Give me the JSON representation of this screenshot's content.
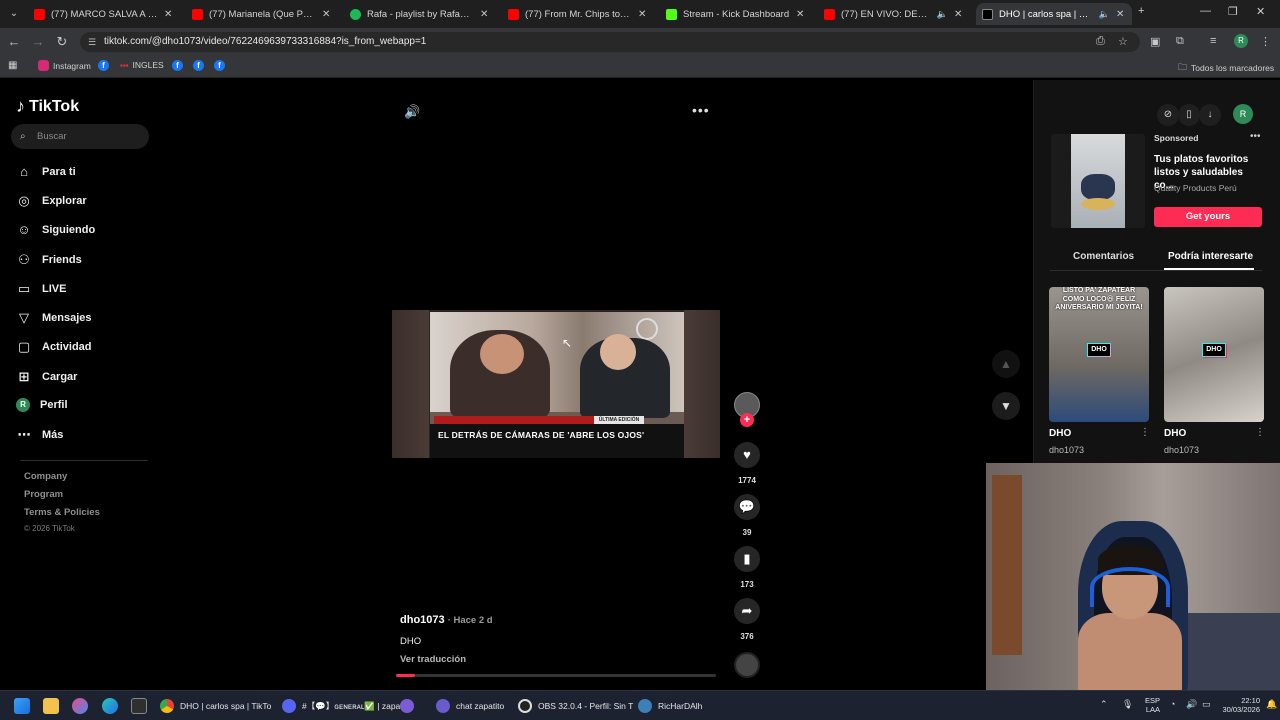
{
  "browser": {
    "tabs": [
      {
        "title": "(77) MARCO SALVA A GRACE D",
        "color": "#ff0000"
      },
      {
        "title": "(77) Marianela (Que Pasa) (Exte",
        "color": "#ff0000"
      },
      {
        "title": "Rafa - playlist by RafaelLxared |",
        "color": "#1db954"
      },
      {
        "title": "(77) From Mr. Chips to Scarface",
        "color": "#ff0000"
      },
      {
        "title": "Stream - Kick Dashboard",
        "color": "#53fc18"
      },
      {
        "title": "(77) EN VIVO: DEBATE PRES",
        "color": "#ff0000"
      },
      {
        "title": "DHO | carlos spa | TikTok",
        "color": "#ffffff"
      }
    ],
    "url": "tiktok.com/@dho1073/video/7622469639733316884?is_from_webapp=1",
    "profile_initial": "R",
    "bookmarks": {
      "instagram": "Instagram",
      "ingles": "INGLES",
      "all_bookmarks": "Todos los marcadores"
    }
  },
  "tiktok": {
    "logo": "TikTok",
    "search_placeholder": "Buscar",
    "nav": {
      "for_you": "Para ti",
      "explore": "Explorar",
      "following": "Siguiendo",
      "friends": "Friends",
      "live": "LIVE",
      "messages": "Mensajes",
      "activity": "Actividad",
      "upload": "Cargar",
      "profile": "Perfil",
      "profile_initial": "R",
      "more": "Más"
    },
    "footer": {
      "company": "Company",
      "program": "Program",
      "terms": "Terms & Policies",
      "copyright": "© 2026 TikTok"
    },
    "video": {
      "caption": "EL DETRÁS DE CÁMARAS DE 'ABRE LOS OJOS'",
      "badge": "ÚLTIMA EDICIÓN",
      "author": "dho1073",
      "time": "· Hace 2 d",
      "description": "DHO",
      "translate": "Ver traducción",
      "progress": 0.06,
      "likes": "1774",
      "comments": "39",
      "saves": "173",
      "shares": "376"
    },
    "panel": {
      "sponsored": "Sponsored",
      "ad_title": "Tus platos favoritos listos y saludables co...",
      "ad_brand": "Quality Products Perú",
      "ad_button": "Get yours",
      "tab_comments": "Comentarios",
      "tab_interest": "Podría interesarte",
      "profile_initial": "R",
      "items": [
        {
          "caption": "LISTO PA' ZAPATEAR COMO LOCO😆 FELIZ ANIVERSARIO MI JOYITA!",
          "tag": "DHO",
          "name": "DHO",
          "user": "dho1073"
        },
        {
          "caption": "",
          "tag": "DHO",
          "name": "DHO",
          "user": "dho1073"
        }
      ]
    }
  },
  "taskbar": {
    "items": {
      "chrome": "DHO | carlos spa | TikTo",
      "discord": "#【💬】ɢᴇɴᴇʀᴀʟ✅ | zapa",
      "chat": "chat zapatito",
      "obs": "OBS 32.0.4 - Perfil: Sin T",
      "rich": "RicHarDAlh"
    },
    "lang": "ESP",
    "lang2": "LAA",
    "time": "22:10",
    "date": "30/03/2026"
  },
  "colors": {
    "tiktok_red": "#fe2c55",
    "tiktok_cyan": "#26f4ee",
    "profile_green": "#2e8b57"
  }
}
